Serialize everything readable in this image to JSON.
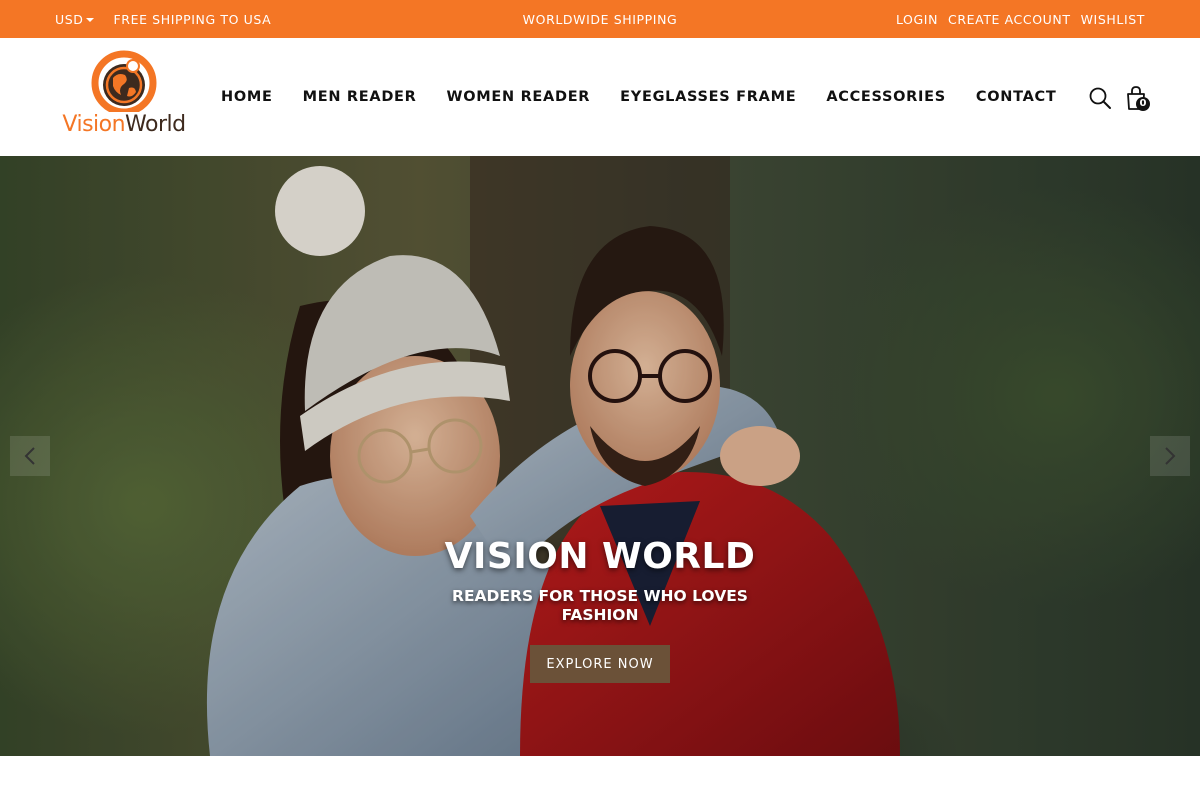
{
  "topbar": {
    "currency": "USD",
    "free_shipping": "FREE SHIPPING TO USA",
    "center_text": "WORLDWIDE SHIPPING",
    "login": "LOGIN",
    "create_account": "CREATE ACCOUNT",
    "wishlist": "WISHLIST",
    "background_color": "#f47625"
  },
  "brand": {
    "name_part1": "Vision",
    "name_part2": "World",
    "primary_color": "#f47625",
    "secondary_color": "#3e2a1e"
  },
  "nav": {
    "items": [
      "HOME",
      "MEN READER",
      "WOMEN READER",
      "EYEGLASSES FRAME",
      "ACCESSORIES",
      "CONTACT"
    ]
  },
  "header_icons": {
    "search": "search-icon",
    "cart": "shopping-bag-icon",
    "cart_count": "0"
  },
  "hero": {
    "title": "VISION WORLD",
    "subtitle": "READERS FOR THOSE WHO LOVES FASHION",
    "button_label": "EXPLORE NOW",
    "button_color": "#6b5138",
    "prev_icon": "chevron-left-icon",
    "next_icon": "chevron-right-icon"
  }
}
